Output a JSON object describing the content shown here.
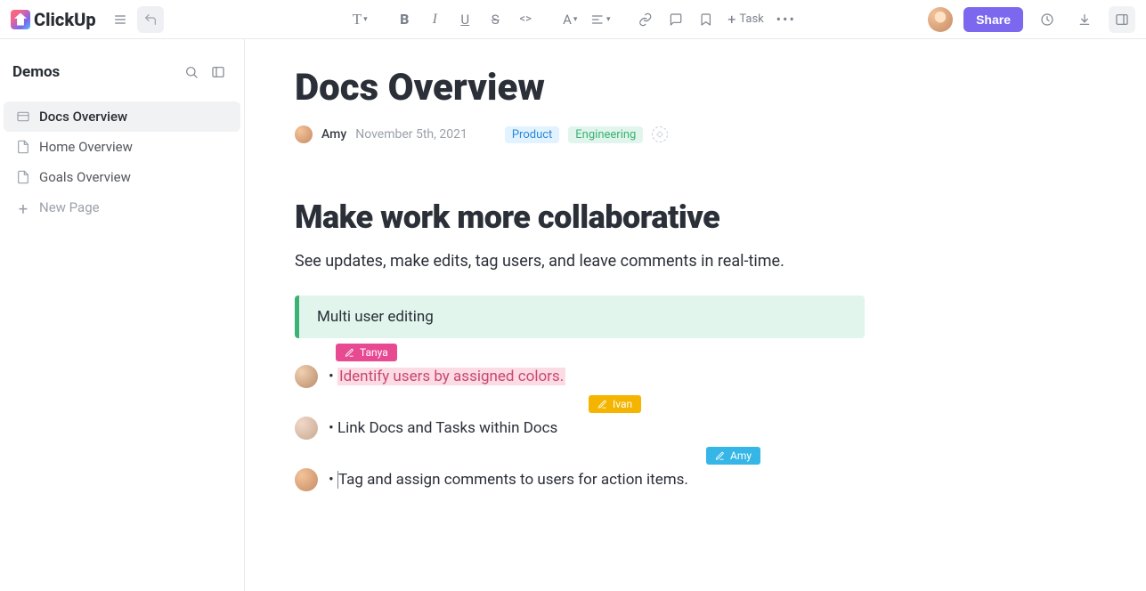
{
  "brand": "ClickUp",
  "toolbar": {
    "task_label": "Task"
  },
  "share_label": "Share",
  "sidebar": {
    "title": "Demos",
    "items": [
      {
        "label": "Docs Overview",
        "icon": "overview-icon"
      },
      {
        "label": "Home Overview",
        "icon": "doc-icon"
      },
      {
        "label": "Goals Overview",
        "icon": "doc-icon"
      }
    ],
    "new_page_label": "New Page"
  },
  "doc": {
    "title": "Docs Overview",
    "author": "Amy",
    "date": "November 5th, 2021",
    "tags": {
      "product": "Product",
      "engineering": "Engineering"
    },
    "heading": "Make work more collaborative",
    "paragraph": "See updates, make edits, tag users, and leave comments in real-time.",
    "callout": "Multi user editing",
    "bullets": [
      {
        "user": "Tanya",
        "text": "Identify users by assigned colors."
      },
      {
        "user": "Ivan",
        "text": "Link Docs and Tasks within Docs"
      },
      {
        "user": "Amy",
        "text": "Tag and assign comments to users for action items."
      }
    ]
  }
}
